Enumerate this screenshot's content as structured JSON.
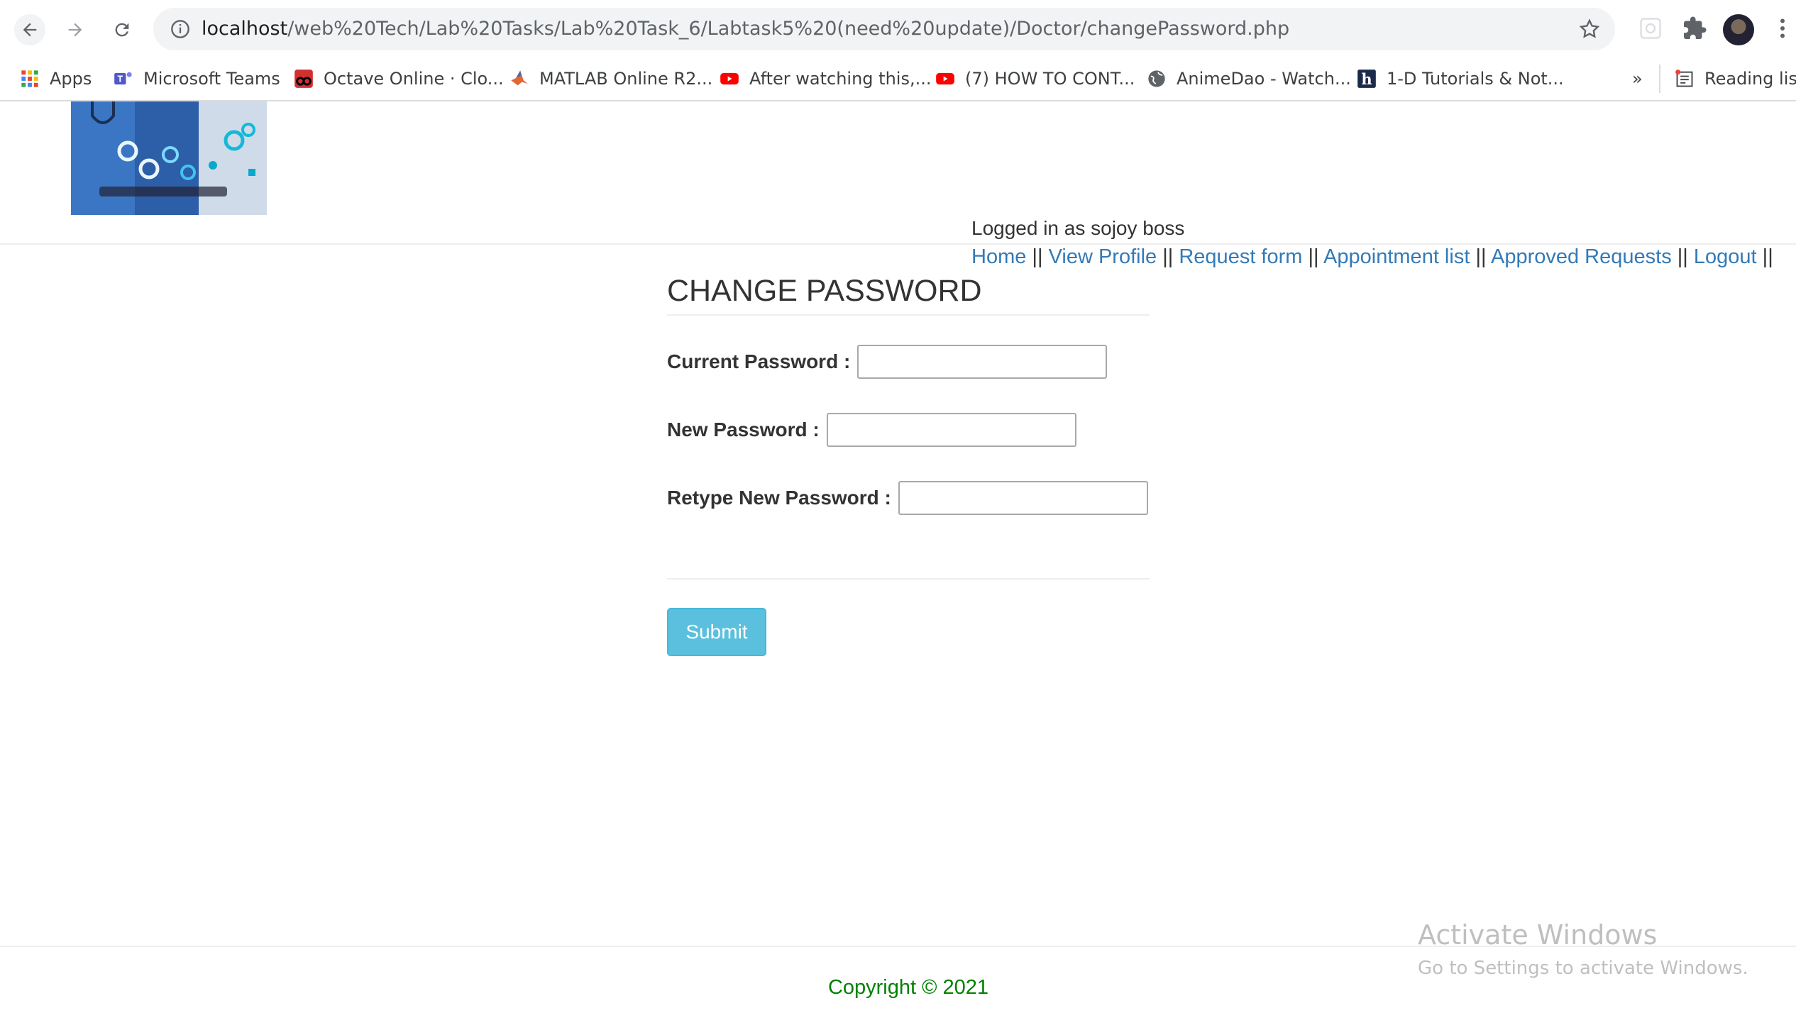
{
  "browser": {
    "url_host": "localhost",
    "url_path": "/web%20Tech/Lab%20Tasks/Lab%20Task_6/Labtask5%20(need%20update)/Doctor/changePassword.php",
    "bookmarks": [
      {
        "label": "Apps",
        "icon": "apps-grid-icon"
      },
      {
        "label": "Microsoft Teams",
        "icon": "teams-icon"
      },
      {
        "label": "Octave Online · Clo...",
        "icon": "octave-icon"
      },
      {
        "label": "MATLAB Online R2...",
        "icon": "matlab-icon"
      },
      {
        "label": "After watching this,...",
        "icon": "youtube-icon"
      },
      {
        "label": "(7) HOW TO CONT...",
        "icon": "youtube-icon"
      },
      {
        "label": "AnimeDao - Watch...",
        "icon": "globe-icon"
      },
      {
        "label": "1-D Tutorials & Not...",
        "icon": "h-icon"
      }
    ],
    "overflow_label": "»",
    "reading_list_label": "Reading list"
  },
  "header": {
    "logged_in_text": "Logged in as sojoy boss",
    "nav": [
      {
        "label": "Home"
      },
      {
        "label": "View Profile"
      },
      {
        "label": "Request form"
      },
      {
        "label": "Appointment list"
      },
      {
        "label": "Approved Requests"
      },
      {
        "label": "Logout"
      }
    ],
    "separator": "||"
  },
  "form": {
    "title": "CHANGE PASSWORD",
    "current_label": "Current Password :",
    "new_label": "New Password :",
    "retype_label": "Retype New Password :",
    "current_value": "",
    "new_value": "",
    "retype_value": "",
    "submit_label": "Submit"
  },
  "footer": {
    "copyright": "Copyright © 2021"
  },
  "watermark": {
    "line1": "Activate Windows",
    "line2": "Go to Settings to activate Windows."
  },
  "colors": {
    "link": "#337ab7",
    "button": "#5bc0de",
    "copyright": "#008000"
  }
}
